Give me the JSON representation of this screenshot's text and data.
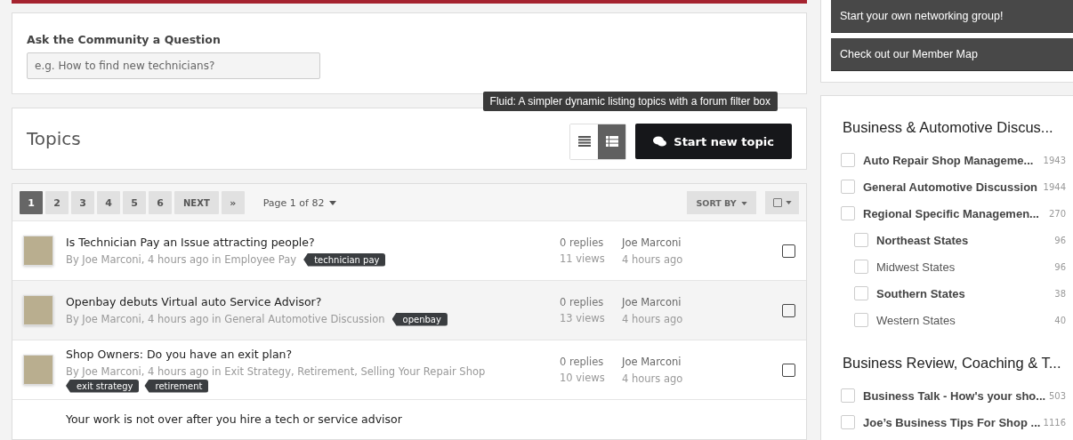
{
  "ask": {
    "label": "Ask the Community a Question",
    "placeholder": "e.g. How to find new technicians?"
  },
  "topics_header": {
    "title": "Topics",
    "tooltip": "Fluid: A simpler dynamic listing topics with a forum filter box",
    "views": [
      {
        "kind": "list",
        "selected": false
      },
      {
        "kind": "table",
        "selected": true
      }
    ],
    "new_topic_button": "Start new topic"
  },
  "pagination": {
    "pages": [
      {
        "label": "1",
        "selected": true
      },
      {
        "label": "2",
        "selected": false
      },
      {
        "label": "3",
        "selected": false
      },
      {
        "label": "4",
        "selected": false
      },
      {
        "label": "5",
        "selected": false
      },
      {
        "label": "6",
        "selected": false
      }
    ],
    "next": "NEXT",
    "last": "»",
    "page_info": "Page 1 of 82",
    "sort_by": "SORT BY"
  },
  "topics": [
    {
      "title": "Is Technician Pay an Issue attracting people?",
      "meta": "By Joe Marconi, 4 hours ago in Employee Pay",
      "tags": [
        "technician pay"
      ],
      "replies": "0 replies",
      "views": "11 views",
      "last_poster": "Joe Marconi",
      "last_time": "4 hours ago",
      "checked": false
    },
    {
      "title": "Openbay debuts Virtual auto Service Advisor?",
      "meta": "By Joe Marconi, 4 hours ago in General Automotive Discussion",
      "tags": [
        "openbay"
      ],
      "replies": "0 replies",
      "views": "13 views",
      "last_poster": "Joe Marconi",
      "last_time": "4 hours ago",
      "checked": false
    },
    {
      "title": "Shop Owners: Do you have an exit plan?",
      "meta": "By Joe Marconi, 4 hours ago in Exit Strategy, Retirement, Selling Your Repair Shop",
      "tags": [
        "exit strategy",
        "retirement"
      ],
      "replies": "0 replies",
      "views": "10 views",
      "last_poster": "Joe Marconi",
      "last_time": "4 hours ago",
      "checked": false
    },
    {
      "title": "Your work is not over after you hire a tech or service advisor",
      "partial": true
    }
  ],
  "sidebar": {
    "links": [
      "Start your own networking group!",
      "Check out our Member Map"
    ],
    "forum_groups": [
      {
        "title": "Business & Automotive Discus...",
        "forums": [
          {
            "name": "Auto Repair Shop Manageme...",
            "count": "1943",
            "unread": true,
            "checked": false
          },
          {
            "name": "General Automotive Discussion",
            "count": "1944",
            "unread": true,
            "checked": false
          },
          {
            "name": "Regional Specific Managemen...",
            "count": "270",
            "unread": true,
            "checked": false,
            "children": [
              {
                "name": "Northeast States",
                "count": "96",
                "unread": true,
                "checked": false
              },
              {
                "name": "Midwest States",
                "count": "96",
                "unread": false,
                "checked": false
              },
              {
                "name": "Southern States",
                "count": "38",
                "unread": true,
                "checked": false
              },
              {
                "name": "Western States",
                "count": "40",
                "unread": false,
                "checked": false
              }
            ]
          }
        ]
      },
      {
        "title": "Business Review, Coaching & T...",
        "forums": [
          {
            "name": "Business Talk - How's your sho...",
            "count": "503",
            "unread": true,
            "checked": false
          },
          {
            "name": "Joe’s Business Tips For Shop ...",
            "count": "1116",
            "unread": true,
            "checked": false
          }
        ]
      }
    ]
  }
}
